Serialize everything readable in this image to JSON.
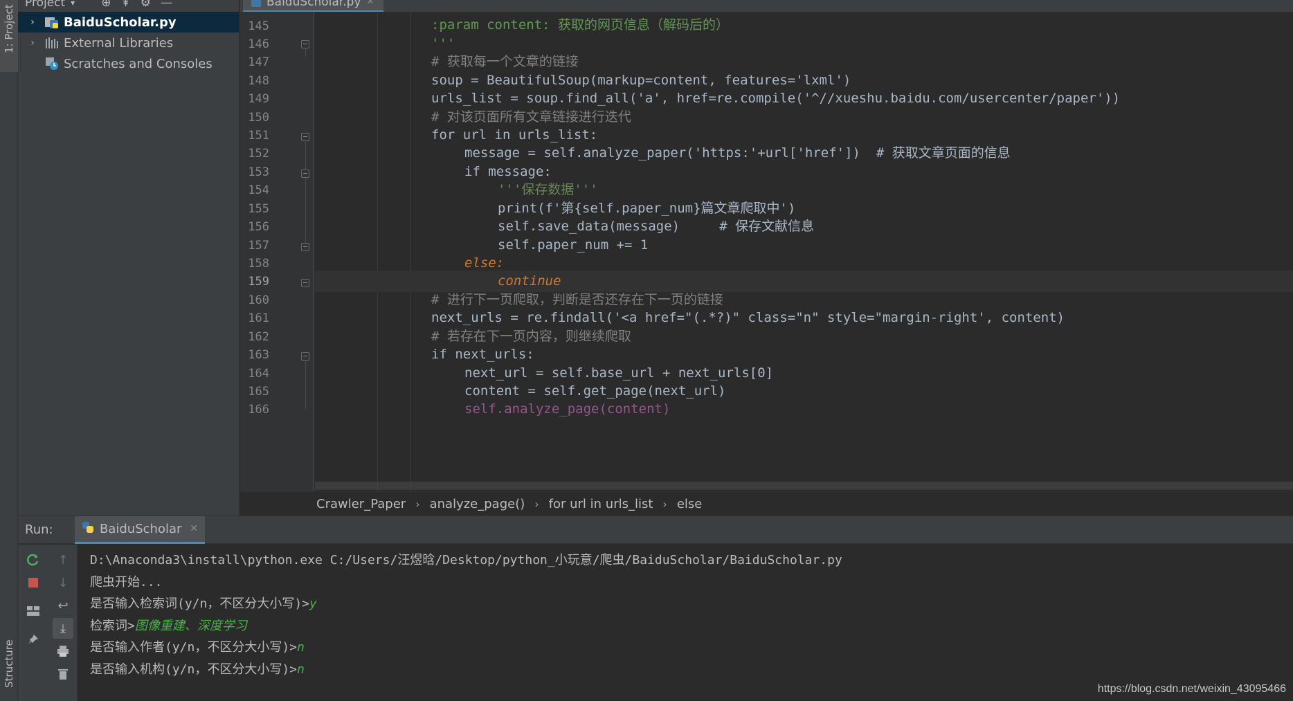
{
  "stripe": {
    "project_tab": "1: Project",
    "structure_tab": "Structure"
  },
  "project_panel": {
    "title": "Project",
    "items": [
      {
        "label": "BaiduScholar.py",
        "icon": "python-file-icon",
        "selected": true
      },
      {
        "label": "External Libraries",
        "icon": "libraries-icon",
        "selected": false
      },
      {
        "label": "Scratches and Consoles",
        "icon": "scratches-icon",
        "selected": false
      }
    ]
  },
  "editor": {
    "tab_label": "BaiduScholar.py",
    "line_numbers": [
      "145",
      "146",
      "147",
      "148",
      "149",
      "150",
      "151",
      "152",
      "153",
      "154",
      "155",
      "156",
      "157",
      "158",
      "159",
      "160",
      "161",
      "162",
      "163",
      "164",
      "165",
      "166"
    ],
    "current_line": "159",
    "lines": [
      ":param content: 获取的网页信息（解码后的）",
      "'''",
      "# 获取每一个文章的链接",
      "soup = BeautifulSoup(markup=content, features='lxml')",
      "urls_list = soup.find_all('a', href=re.compile('^//xueshu.baidu.com/usercenter/paper'))",
      "# 对该页面所有文章链接进行迭代",
      "for url in urls_list:",
      "message = self.analyze_paper('https:'+url['href'])  # 获取文章页面的信息",
      "if message:",
      "'''保存数据'''",
      "print(f'第{self.paper_num}篇文章爬取中')",
      "self.save_data(message)     # 保存文献信息",
      "self.paper_num += 1",
      "else:",
      "continue",
      "# 进行下一页爬取，判断是否还存在下一页的链接",
      "next_urls = re.findall('<a href=\"(.*?)\" class=\"n\" style=\"margin-right', content)",
      "# 若存在下一页内容，则继续爬取",
      "if next_urls:",
      "next_url = self.base_url + next_urls[0]",
      "content = self.get_page(next_url)",
      "self.analyze_page(content)"
    ],
    "breadcrumbs": [
      "Crawler_Paper",
      "analyze_page()",
      "for url in urls_list",
      "else"
    ]
  },
  "run_panel": {
    "label": "Run:",
    "tab_label": "BaiduScholar",
    "console_lines": [
      {
        "text": "D:\\Anaconda3\\install\\python.exe C:/Users/汪煜晗/Desktop/python_小玩意/爬虫/BaiduScholar/BaiduScholar.py",
        "input": ""
      },
      {
        "text": "爬虫开始...",
        "input": ""
      },
      {
        "text": "是否输入检索词(y/n，不区分大小写)>",
        "input": "y"
      },
      {
        "text": "检索词>",
        "input": "图像重建、深度学习"
      },
      {
        "text": "是否输入作者(y/n，不区分大小写)>",
        "input": "n"
      },
      {
        "text": "是否输入机构(y/n，不区分大小写)>",
        "input": "n"
      }
    ]
  },
  "watermark": "https://blog.csdn.net/weixin_43095466",
  "colors": {
    "background": "#2b2b2b",
    "panel": "#3c3f41",
    "keyword": "#cc7832",
    "string": "#6a8759",
    "comment": "#808080",
    "number": "#6897bb",
    "self": "#94558d",
    "selection": "#0d293e",
    "console_input": "#4cb04c"
  }
}
